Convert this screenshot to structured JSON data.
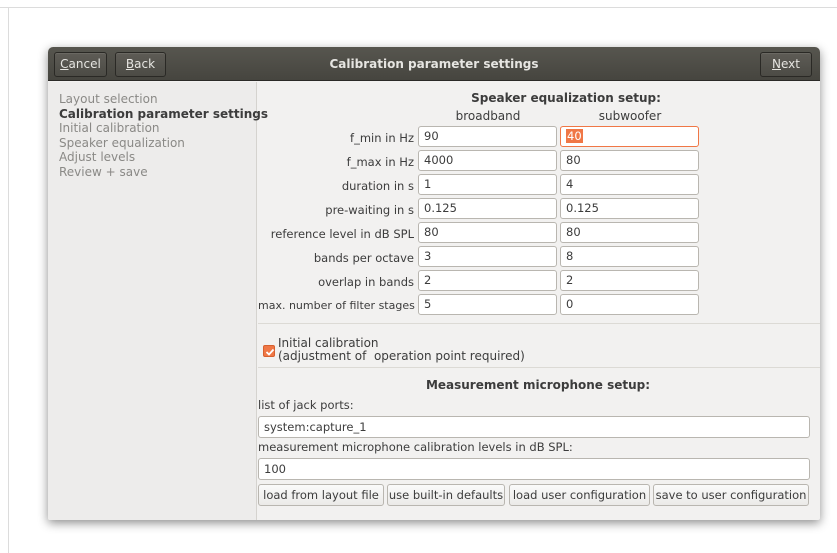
{
  "dialog": {
    "title": "Calibration parameter settings",
    "buttons": {
      "cancel": {
        "accel": "C",
        "rest": "ancel"
      },
      "back": {
        "accel": "B",
        "rest": "ack"
      },
      "next": {
        "accel": "N",
        "rest": "ext"
      }
    }
  },
  "sidebar": {
    "steps": [
      {
        "label": "Layout selection",
        "active": false
      },
      {
        "label": "Calibration parameter settings",
        "active": true
      },
      {
        "label": "Initial calibration",
        "active": false
      },
      {
        "label": "Speaker equalization",
        "active": false
      },
      {
        "label": "Adjust levels",
        "active": false
      },
      {
        "label": "Review + save",
        "active": false
      }
    ]
  },
  "speaker_eq": {
    "title": "Speaker equalization setup:",
    "columns": [
      "broadband",
      "subwoofer"
    ],
    "rows": [
      {
        "label": "f_min in Hz",
        "broadband": "90",
        "subwoofer": "40"
      },
      {
        "label": "f_max in Hz",
        "broadband": "4000",
        "subwoofer": "80"
      },
      {
        "label": "duration in s",
        "broadband": "1",
        "subwoofer": "4"
      },
      {
        "label": "pre-waiting in s",
        "broadband": "0.125",
        "subwoofer": "0.125"
      },
      {
        "label": "reference level in dB SPL",
        "broadband": "80",
        "subwoofer": "80"
      },
      {
        "label": "bands per octave",
        "broadband": "3",
        "subwoofer": "8"
      },
      {
        "label": "overlap in bands",
        "broadband": "2",
        "subwoofer": "2"
      },
      {
        "label": "max. number of filter stages",
        "broadband": "5",
        "subwoofer": "0"
      }
    ]
  },
  "initial_calibration": {
    "checked": true,
    "label_line1": "Initial calibration",
    "label_line2": "(adjustment of  operation point required)"
  },
  "microphone": {
    "title": "Measurement microphone setup:",
    "ports_label": "list of jack ports:",
    "ports_value": "system:capture_1",
    "levels_label": "measurement microphone calibration levels in dB SPL:",
    "levels_value": "100"
  },
  "actions": {
    "load_layout": "load from layout file",
    "builtin_defaults": "use built-in defaults",
    "load_user": "load user configuration",
    "save_user": "save to user configuration"
  },
  "colors": {
    "accent": "#f07746",
    "headerbar": "#4e4d47",
    "dialog_bg": "#f2f1f0"
  }
}
